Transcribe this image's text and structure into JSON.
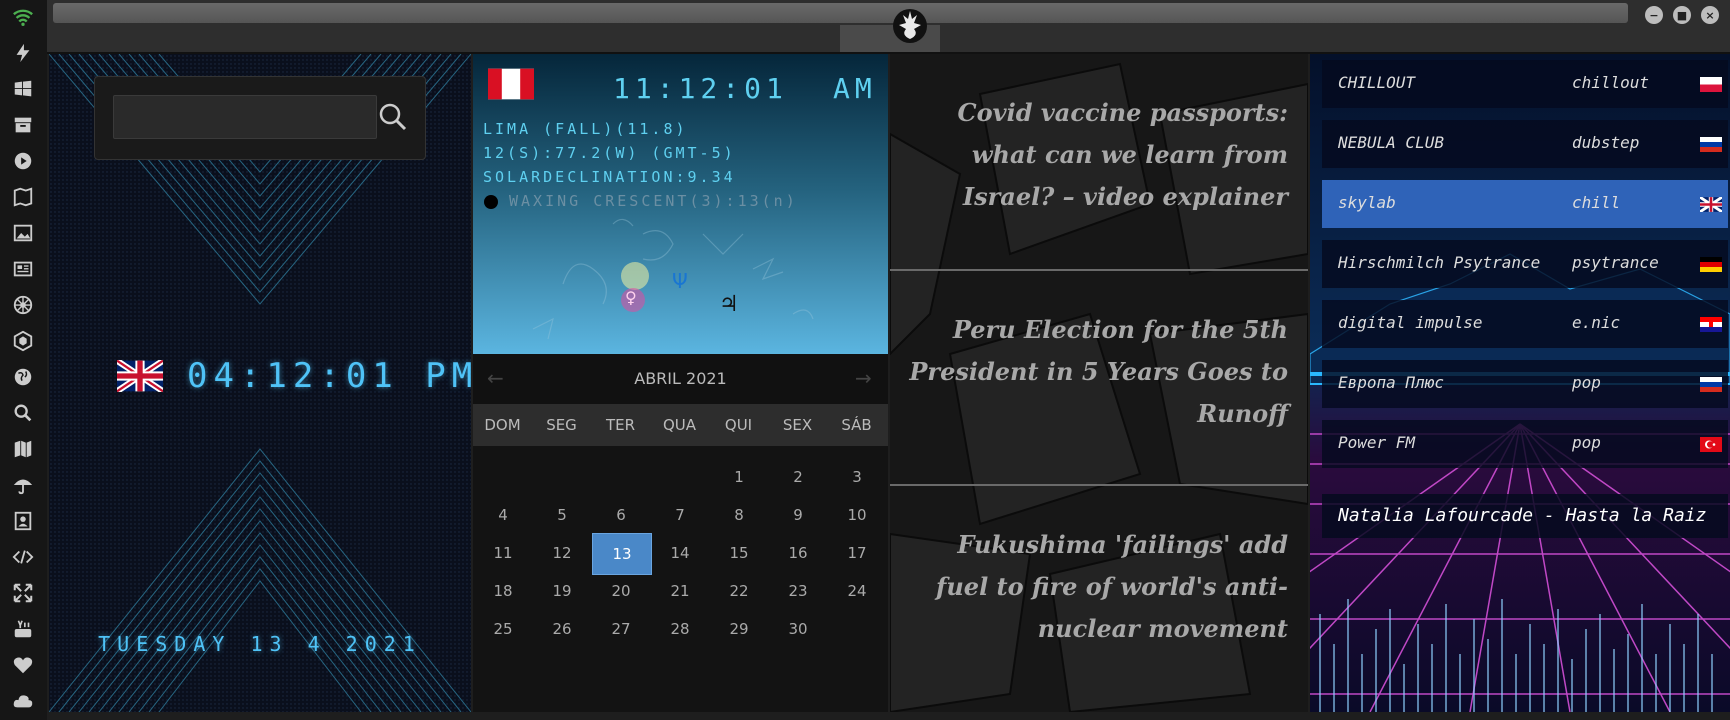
{
  "colors": {
    "accent": "#4fc3f7",
    "selected_day": "#4a88c8",
    "selected_station": "#2f63b8",
    "wifi": "#4caf50"
  },
  "left_toolbar": {
    "icons": [
      "wifi-icon",
      "bolt-icon",
      "windows-icon",
      "archive-icon",
      "play-icon",
      "map-book-icon",
      "image-icon",
      "news-icon",
      "settings-wheel-icon",
      "hexagon-icon",
      "globe-icon",
      "search-icon",
      "map-icon",
      "umbrella-icon",
      "contact-icon",
      "code-icon",
      "expand-icon",
      "youtube-icon",
      "heart-icon",
      "cloud-icon"
    ]
  },
  "window": {
    "logo": "rebel-alliance-logo-icon",
    "controls": [
      "minimize-icon",
      "maximize-icon",
      "close-icon"
    ]
  },
  "search": {
    "value": "",
    "icon": "search-icon"
  },
  "clock": {
    "time": "04:12:01 PM",
    "date": "TUESDAY 13 4 2021",
    "flag": "uk-flag-icon"
  },
  "weather": {
    "flag": "peru-flag-icon",
    "time": "11:12:01",
    "ampm": "AM",
    "line1": "LIMA (FALL)(11.8)",
    "line2": "12(S):77.2(W) (GMT-5)",
    "line3": "SOLARDECLINATION:9.34",
    "moon": "WAXING CRESCENT(3):13(n)",
    "planets": [
      "♀",
      "Ψ",
      "♃"
    ]
  },
  "calendar": {
    "month": "ABRIL 2021",
    "prev": "←",
    "next": "→",
    "day_names": [
      "DOM",
      "SEG",
      "TER",
      "QUA",
      "QUI",
      "SEX",
      "SÁB"
    ],
    "weeks": [
      [
        "",
        "",
        "",
        "",
        "1",
        "2",
        "3"
      ],
      [
        "4",
        "5",
        "6",
        "7",
        "8",
        "9",
        "10"
      ],
      [
        "11",
        "12",
        "13",
        "14",
        "15",
        "16",
        "17"
      ],
      [
        "18",
        "19",
        "20",
        "21",
        "22",
        "23",
        "24"
      ],
      [
        "25",
        "26",
        "27",
        "28",
        "29",
        "30",
        ""
      ]
    ],
    "today": "13"
  },
  "news": [
    "Covid vaccine passports: what can we learn from Israel? – video explainer",
    "Peru Election for the 5th President in 5 Years Goes to Runoff",
    "Fukushima 'failings' add fuel to fire of world's anti-nuclear movement"
  ],
  "radio": {
    "stations": [
      {
        "name": "CHILLOUT",
        "genre": "chillout",
        "flag": "poland-flag-icon"
      },
      {
        "name": "NEBULA CLUB",
        "genre": "dubstep",
        "flag": "russia-flag-icon"
      },
      {
        "name": "skylab",
        "genre": "chill",
        "flag": "uk-flag-icon"
      },
      {
        "name": "Hirschmilch Psytrance",
        "genre": "psytrance",
        "flag": "germany-flag-icon"
      },
      {
        "name": "digital impulse",
        "genre": "e.nic",
        "flag": "croatia-flag-icon"
      },
      {
        "name": "Европа Плюс",
        "genre": "pop",
        "flag": "russia-flag-icon"
      },
      {
        "name": "Power FM",
        "genre": "pop",
        "flag": "turkey-flag-icon"
      }
    ],
    "active_index": 2,
    "now_playing": "Natalia Lafourcade - Hasta la Raiz"
  }
}
